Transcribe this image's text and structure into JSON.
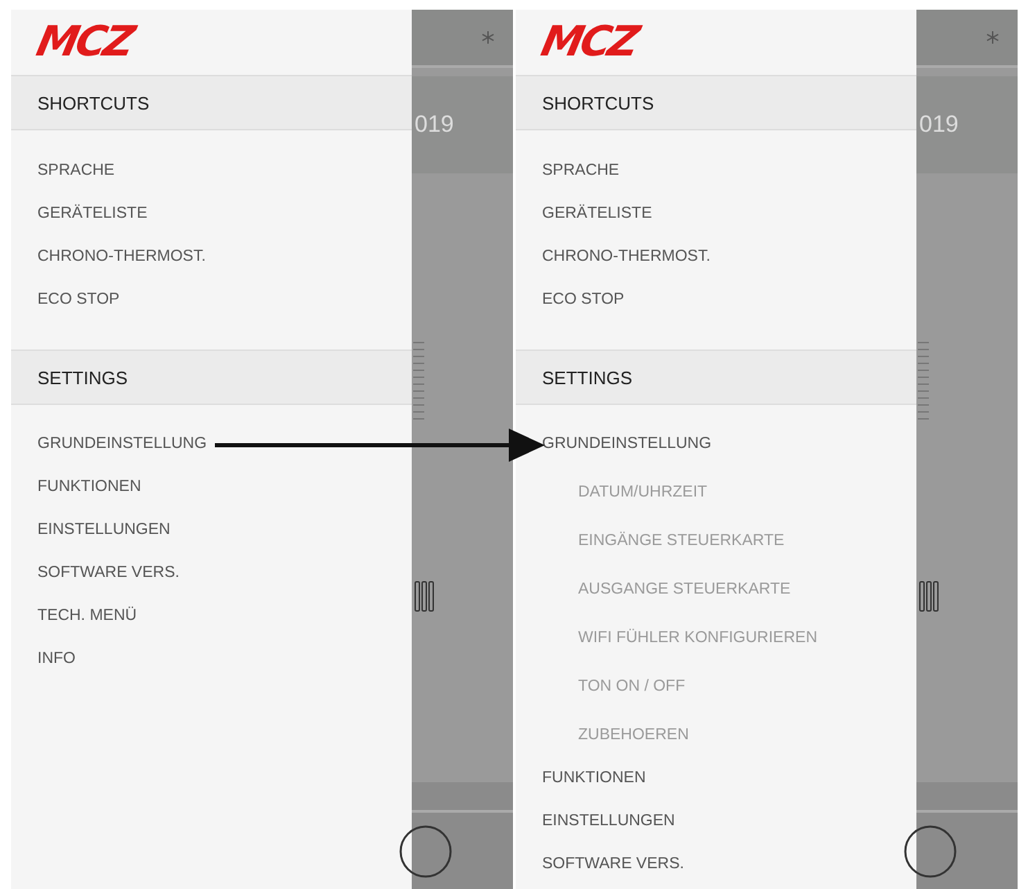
{
  "screens": [
    {
      "logo": "MCZ",
      "backdrop": {
        "year": "019"
      },
      "sections": [
        {
          "title": "SHORTCUTS",
          "items": [
            {
              "label": "SPRACHE"
            },
            {
              "label": "GERÄTELISTE"
            },
            {
              "label": "CHRONO-THERMOST."
            },
            {
              "label": "ECO STOP"
            }
          ]
        },
        {
          "title": "SETTINGS",
          "items": [
            {
              "label": "GRUNDEINSTELLUNG"
            },
            {
              "label": "FUNKTIONEN"
            },
            {
              "label": "EINSTELLUNGEN"
            },
            {
              "label": "SOFTWARE VERS."
            },
            {
              "label": "TECH. MENÜ"
            },
            {
              "label": "INFO"
            }
          ]
        }
      ]
    },
    {
      "logo": "MCZ",
      "backdrop": {
        "year": "019"
      },
      "sections": [
        {
          "title": "SHORTCUTS",
          "items": [
            {
              "label": "SPRACHE"
            },
            {
              "label": "GERÄTELISTE"
            },
            {
              "label": "CHRONO-THERMOST."
            },
            {
              "label": "ECO STOP"
            }
          ]
        },
        {
          "title": "SETTINGS",
          "items": [
            {
              "label": "GRUNDEINSTELLUNG",
              "children": [
                {
                  "label": "DATUM/UHRZEIT"
                },
                {
                  "label": "EINGÄNGE STEUERKARTE"
                },
                {
                  "label": "AUSGANGE STEUERKARTE"
                },
                {
                  "label": "WIFI FÜHLER KONFIGURIEREN"
                },
                {
                  "label": "TON ON / OFF"
                },
                {
                  "label": "ZUBEHOEREN"
                }
              ]
            },
            {
              "label": "FUNKTIONEN"
            },
            {
              "label": "EINSTELLUNGEN"
            },
            {
              "label": "SOFTWARE VERS."
            }
          ]
        }
      ]
    }
  ]
}
